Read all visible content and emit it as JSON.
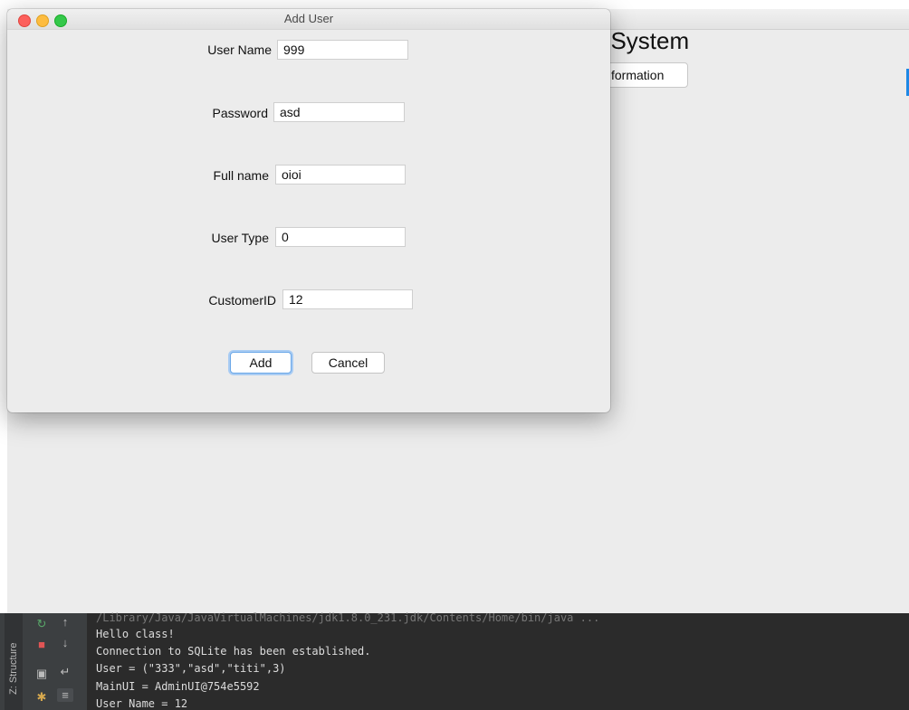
{
  "main_window": {
    "title_partial": "t System",
    "info_button_label": "formation"
  },
  "dialog": {
    "title": "Add User",
    "fields": [
      {
        "label": "User Name",
        "value": "999"
      },
      {
        "label": "Password",
        "value": "asd"
      },
      {
        "label": "Full name",
        "value": "oioi"
      },
      {
        "label": "User Type",
        "value": "0"
      },
      {
        "label": "CustomerID",
        "value": "12"
      }
    ],
    "add_label": "Add",
    "cancel_label": "Cancel"
  },
  "console": {
    "structure_tab_label": "Z: Structure",
    "lines": [
      "/Library/Java/JavaVirtualMachines/jdk1.8.0_231.jdk/Contents/Home/bin/java ...",
      "Hello class!",
      "Connection to SQLite has been established.",
      "User = (\"333\",\"asd\",\"titi\",3)",
      "MainUI = AdminUI@754e5592",
      "User Name = 12"
    ]
  },
  "colors": {
    "close": "#fc605c",
    "minimize": "#fdbc40",
    "maximize": "#34c84a",
    "console_bg": "#2b2b2b",
    "accent": "#6aa7e8"
  }
}
